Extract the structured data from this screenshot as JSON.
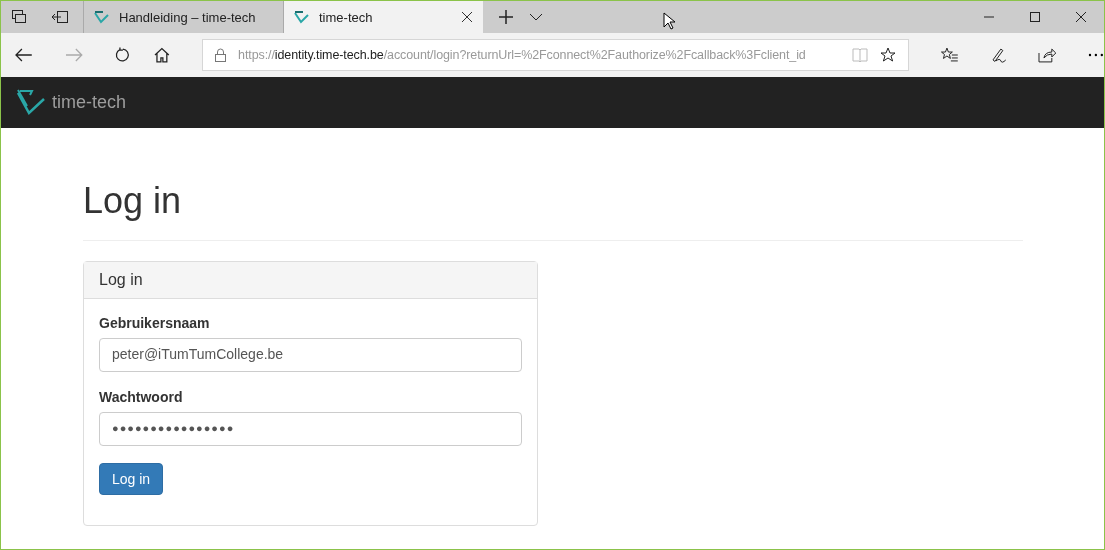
{
  "tabs": [
    {
      "label": "Handleiding – time-tech",
      "selected": false
    },
    {
      "label": "time-tech",
      "selected": true
    }
  ],
  "address": {
    "scheme": "https://",
    "host": "identity.time-tech.be",
    "path": "/account/login?returnUrl=%2Fconnect%2Fauthorize%2Fcallback%3Fclient_id"
  },
  "brand": "time-tech",
  "heading": "Log in",
  "panel": {
    "title": "Log in",
    "fields": [
      {
        "label": "Gebruikersnaam",
        "value": "peter@iTumTumCollege.be"
      },
      {
        "label": "Wachtwoord",
        "value": "●●●●●●●●●●●●●●●●"
      }
    ],
    "button": "Log in"
  }
}
